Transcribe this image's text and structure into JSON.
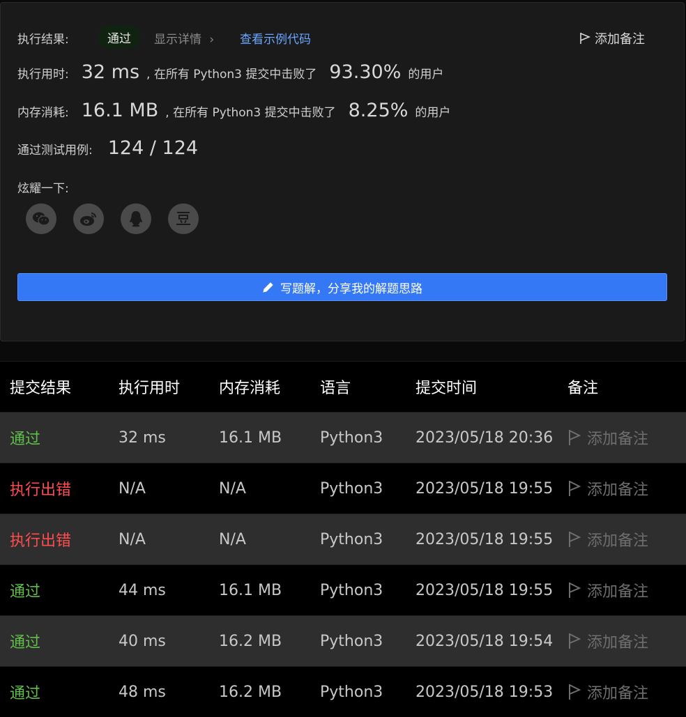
{
  "result": {
    "label": "执行结果:",
    "status": "通过",
    "show_details": "显示详情",
    "view_example": "查看示例代码",
    "add_note": "添加备注"
  },
  "runtime": {
    "label": "执行用时:",
    "value": "32 ms",
    "middle": ", 在所有 Python3 提交中击败了",
    "percent": "93.30%",
    "suffix": "的用户"
  },
  "memory": {
    "label": "内存消耗:",
    "value": "16.1 MB",
    "middle": ", 在所有 Python3 提交中击败了",
    "percent": "8.25%",
    "suffix": "的用户"
  },
  "tests": {
    "label": "通过测试用例:",
    "value": "124 / 124"
  },
  "share": {
    "label": "炫耀一下:",
    "icons": [
      "wechat-icon",
      "weibo-icon",
      "qq-icon",
      "douban-icon"
    ]
  },
  "write_solution": "写题解，分享我的解题思路",
  "table": {
    "headers": [
      "提交结果",
      "执行用时",
      "内存消耗",
      "语言",
      "提交时间",
      "备注"
    ],
    "rows": [
      {
        "status": "通过",
        "type": "ok",
        "time": "32 ms",
        "memory": "16.1 MB",
        "lang": "Python3",
        "date": "2023/05/18 20:36",
        "note": "添加备注"
      },
      {
        "status": "执行出错",
        "type": "err",
        "time": "N/A",
        "memory": "N/A",
        "lang": "Python3",
        "date": "2023/05/18 19:55",
        "note": "添加备注"
      },
      {
        "status": "执行出错",
        "type": "err",
        "time": "N/A",
        "memory": "N/A",
        "lang": "Python3",
        "date": "2023/05/18 19:55",
        "note": "添加备注"
      },
      {
        "status": "通过",
        "type": "ok",
        "time": "44 ms",
        "memory": "16.1 MB",
        "lang": "Python3",
        "date": "2023/05/18 19:55",
        "note": "添加备注"
      },
      {
        "status": "通过",
        "type": "ok",
        "time": "40 ms",
        "memory": "16.2 MB",
        "lang": "Python3",
        "date": "2023/05/18 19:54",
        "note": "添加备注"
      },
      {
        "status": "通过",
        "type": "ok",
        "time": "48 ms",
        "memory": "16.2 MB",
        "lang": "Python3",
        "date": "2023/05/18 19:53",
        "note": "添加备注"
      }
    ]
  },
  "colors": {
    "accept": "#5fbf49",
    "error": "#ff4d4f",
    "link": "#6aa7ff",
    "button": "#3478f6"
  }
}
